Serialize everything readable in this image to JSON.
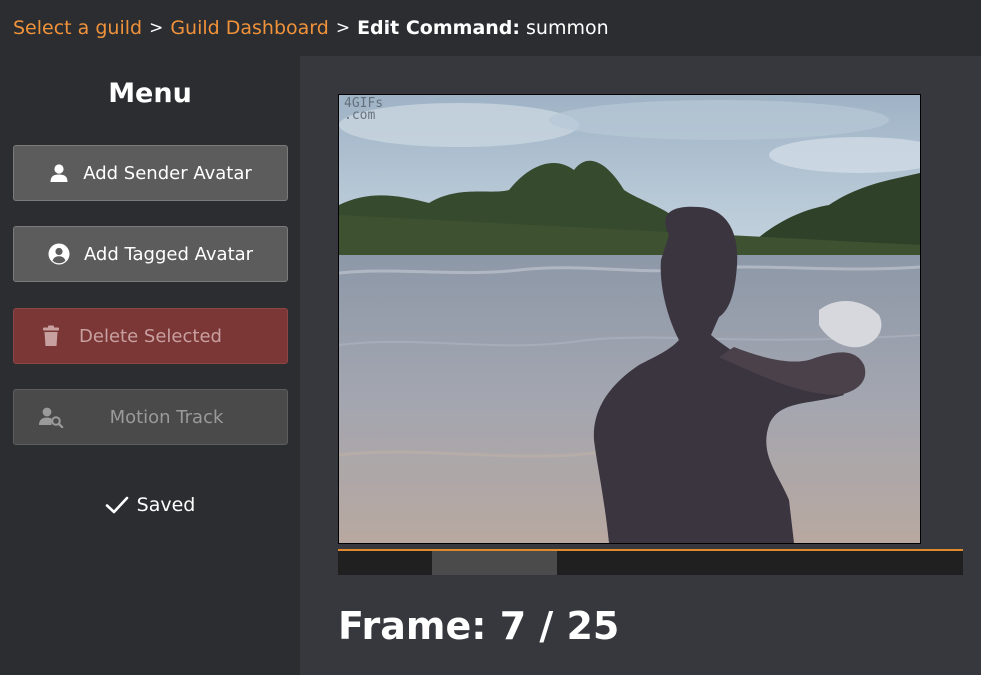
{
  "breadcrumb": {
    "item1": "Select a guild",
    "item2": "Guild Dashboard",
    "current_label": "Edit Command:",
    "current_value": "summon",
    "separator": ">"
  },
  "sidebar": {
    "title": "Menu",
    "buttons": {
      "add_sender": "Add Sender Avatar",
      "add_tagged": "Add Tagged Avatar",
      "delete_selected": "Delete Selected",
      "motion_track": "Motion Track"
    },
    "status": "Saved"
  },
  "preview": {
    "watermark": "4GIFs\n.com",
    "frame_prefix": "Frame:",
    "current_frame": 7,
    "total_frames": 25,
    "frame_text": "Frame: 7 / 25"
  },
  "colors": {
    "accent": "#f0923a",
    "delete_bg": "#7b3636",
    "panel_bg": "#2b2d31",
    "main_bg": "#36383d"
  },
  "icons": [
    "user-icon",
    "user-circle-icon",
    "trash-icon",
    "user-search-icon",
    "check-icon"
  ]
}
